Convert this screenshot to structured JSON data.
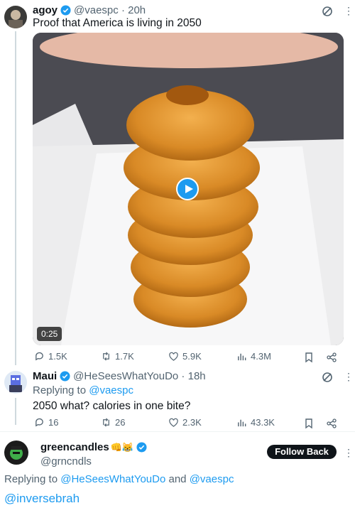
{
  "tweet1": {
    "name": "agoy",
    "handle": "@vaespc",
    "time": "20h",
    "text": "Proof that America is living in 2050",
    "video_duration": "0:25",
    "stats": {
      "replies": "1.5K",
      "retweets": "1.7K",
      "likes": "5.9K",
      "views": "4.3M"
    }
  },
  "tweet2": {
    "name": "Maui",
    "handle": "@HeSeesWhatYouDo",
    "time": "18h",
    "replying_prefix": "Replying to",
    "replying_to": "@vaespc",
    "text": "2050 what?  calories in one bite?",
    "stats": {
      "replies": "16",
      "retweets": "26",
      "likes": "2.3K",
      "views": "43.3K"
    }
  },
  "tweet3": {
    "name": "greencandles",
    "handle": "@grncndls",
    "follow_label": "Follow Back",
    "replying_prefix": "Replying to",
    "replying_to_1": "@HeSeesWhatYouDo",
    "replying_and": "and",
    "replying_to_2": "@vaespc",
    "mention": "@inversebrah"
  },
  "colors": {
    "accent": "#1d9bf0",
    "muted": "#536471",
    "text": "#0f1419"
  }
}
